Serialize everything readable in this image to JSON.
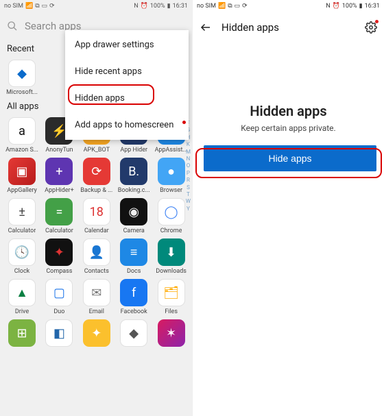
{
  "status": {
    "carrier": "no SIM",
    "nfc": "N",
    "battery": "100%",
    "time": "16:31"
  },
  "left": {
    "search_placeholder": "Search apps",
    "recent_label": "Recent",
    "allapps_label": "All apps",
    "recent_apps": [
      {
        "label": "Microsoft...",
        "bg": "bg-white",
        "glyph": "◆",
        "color": "#0b6bcb"
      }
    ],
    "apps": [
      {
        "label": "Amazon S...",
        "bg": "bg-amazon",
        "glyph": "a",
        "color": "#111"
      },
      {
        "label": "AnonyTun",
        "bg": "bg-dark",
        "glyph": "⚡",
        "color": "#9ff"
      },
      {
        "label": "APK_BOT",
        "bg": "bg-orange",
        "glyph": "★",
        "color": "#fff"
      },
      {
        "label": "App Hider",
        "bg": "bg-navy",
        "glyph": "🎭",
        "color": "#fff"
      },
      {
        "label": "AppAssist...",
        "bg": "bg-blue",
        "glyph": "✦",
        "color": "#fff"
      },
      {
        "label": "AppGallery",
        "bg": "bg-redgrad",
        "glyph": "▣",
        "color": "#fff"
      },
      {
        "label": "AppHider+",
        "bg": "bg-purple",
        "glyph": "+",
        "color": "#fff"
      },
      {
        "label": "Backup & ...",
        "bg": "bg-red",
        "glyph": "⟳",
        "color": "#fff"
      },
      {
        "label": "Booking.c...",
        "bg": "bg-navy",
        "glyph": "B.",
        "color": "#fff"
      },
      {
        "label": "Browser",
        "bg": "bg-lightblue",
        "glyph": "●",
        "color": "#fff"
      },
      {
        "label": "Calculator",
        "bg": "bg-white",
        "glyph": "±",
        "color": "#444"
      },
      {
        "label": "Calculator",
        "bg": "bg-green",
        "glyph": "=",
        "color": "#fff"
      },
      {
        "label": "Calendar",
        "bg": "bg-white",
        "glyph": "18",
        "color": "#d33"
      },
      {
        "label": "Camera",
        "bg": "bg-black",
        "glyph": "◉",
        "color": "#eee"
      },
      {
        "label": "Chrome",
        "bg": "bg-white",
        "glyph": "◯",
        "color": "#4285f4"
      },
      {
        "label": "Clock",
        "bg": "bg-white",
        "glyph": "🕓",
        "color": "#333"
      },
      {
        "label": "Compass",
        "bg": "bg-black",
        "glyph": "✦",
        "color": "#d33"
      },
      {
        "label": "Contacts",
        "bg": "bg-white",
        "glyph": "👤",
        "color": "#555"
      },
      {
        "label": "Docs",
        "bg": "bg-blue",
        "glyph": "≡",
        "color": "#fff"
      },
      {
        "label": "Downloads",
        "bg": "bg-teal",
        "glyph": "⬇",
        "color": "#fff"
      },
      {
        "label": "Drive",
        "bg": "bg-gdrive",
        "glyph": "▲",
        "color": "#0b8043"
      },
      {
        "label": "Duo",
        "bg": "bg-duo",
        "glyph": "▢",
        "color": "#1a73e8"
      },
      {
        "label": "Email",
        "bg": "bg-white",
        "glyph": "✉",
        "color": "#777"
      },
      {
        "label": "Facebook",
        "bg": "bg-bluefb",
        "glyph": "f",
        "color": "#fff"
      },
      {
        "label": "Files",
        "bg": "bg-white",
        "glyph": "🗂",
        "color": "#fa0"
      },
      {
        "label": "",
        "bg": "bg-greenlt",
        "glyph": "⊞",
        "color": "#fff"
      },
      {
        "label": "",
        "bg": "bg-white",
        "glyph": "◧",
        "color": "#26a"
      },
      {
        "label": "",
        "bg": "bg-yellow",
        "glyph": "✦",
        "color": "#fff"
      },
      {
        "label": "",
        "bg": "bg-white",
        "glyph": "◆",
        "color": "#555"
      },
      {
        "label": "",
        "bg": "bg-fuchsia",
        "glyph": "✶",
        "color": "#fff"
      }
    ],
    "az": [
      "F",
      "G",
      "H",
      "K",
      "M",
      "N",
      "O",
      "P",
      "R",
      "S",
      "T",
      "W",
      "Y"
    ],
    "popup": {
      "settings": "App drawer settings",
      "hide_recent": "Hide recent apps",
      "hidden": "Hidden apps",
      "add_home": "Add apps to homescreen"
    }
  },
  "right": {
    "header_title": "Hidden apps",
    "heading": "Hidden apps",
    "subheading": "Keep certain apps private.",
    "button": "Hide apps"
  }
}
